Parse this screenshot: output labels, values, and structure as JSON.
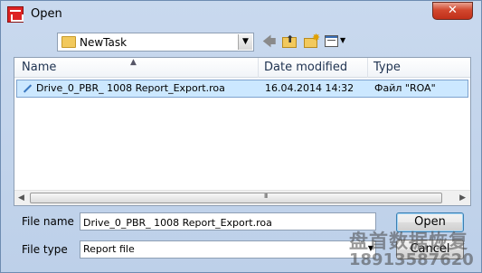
{
  "window": {
    "title": "Open",
    "close_label": "✕"
  },
  "toolbar": {
    "folder": "NewTask",
    "back_icon": "back-arrow-icon",
    "up_icon": "up-folder-icon",
    "new_folder_icon": "new-folder-icon",
    "view_icon": "view-menu-icon"
  },
  "columns": {
    "name": "Name",
    "date": "Date modified",
    "type": "Type"
  },
  "files": [
    {
      "name": "Drive_0_PBR_ 1008 Report_Export.roa",
      "date": "16.04.2014 14:32",
      "type": "Файл \"ROA\""
    }
  ],
  "scrollbar": {
    "grip": "III"
  },
  "filename": {
    "label": "File name",
    "value": "Drive_0_PBR_ 1008 Report_Export.roa"
  },
  "filetype": {
    "label": "File type",
    "value": "Report file"
  },
  "buttons": {
    "open": "Open",
    "cancel": "Cancel"
  },
  "watermark": {
    "line1": "盘首数据恢复",
    "line2": "18913587620"
  },
  "colors": {
    "selection": "#cce8ff",
    "close": "#c1301a",
    "chrome": "#c9d9ee"
  }
}
